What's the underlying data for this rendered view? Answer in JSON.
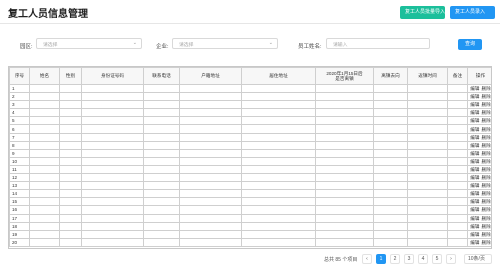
{
  "header": {
    "title": "复工人员信息管理",
    "import_label": "复工人员批量导入",
    "add_label": "复工人员录入"
  },
  "filter": {
    "area_label": "园区:",
    "area_placeholder": "请选择",
    "company_label": "企业:",
    "company_placeholder": "请选择",
    "name_label": "员工姓名:",
    "name_placeholder": "请输入",
    "search_label": "查询"
  },
  "table": {
    "columns": [
      "序号",
      "姓名",
      "性别",
      "身份证号码",
      "联系电话",
      "户籍地址",
      "居住地址",
      "2020年1月15日后\n是否离镇",
      "离镇去向",
      "返镇时间",
      "备注",
      "操作"
    ],
    "rows": [
      "1",
      "2",
      "3",
      "4",
      "5",
      "6",
      "7",
      "8",
      "9",
      "10",
      "11",
      "12",
      "13",
      "14",
      "15",
      "16",
      "17",
      "18",
      "19",
      "20"
    ],
    "edit_label": "编辑",
    "delete_label": "删除"
  },
  "pager": {
    "total": "总共 85 个项目",
    "prev": "‹",
    "pages": [
      "1",
      "2",
      "3",
      "4",
      "5"
    ],
    "next": "›",
    "size": "10条/页"
  }
}
